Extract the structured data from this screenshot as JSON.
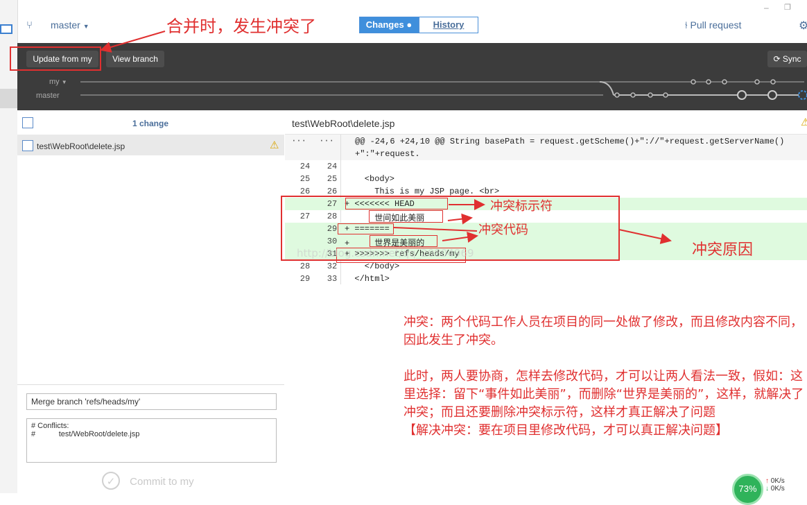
{
  "header": {
    "branch": "master",
    "tabs": [
      {
        "label": "Changes"
      },
      {
        "label": "History"
      }
    ],
    "pull_request": "Pull request"
  },
  "toolbar": {
    "update_button": "Update from my",
    "view_branch": "View branch",
    "sync": "Sync",
    "graph_labels": [
      "my",
      "master"
    ]
  },
  "changes": {
    "count_label": "1 change",
    "files": [
      {
        "path": "test\\WebRoot\\delete.jsp"
      }
    ]
  },
  "commit": {
    "summary": "Merge branch 'refs/heads/my'",
    "description_line1": "# Conflicts:",
    "description_line2": "#           test/WebRoot/delete.jsp",
    "button": "Commit to my"
  },
  "diff": {
    "file_path": "test\\WebRoot\\delete.jsp",
    "hunk_header": "@@ -24,6 +24,10 @@ String basePath = request.getScheme()+\"://\"+request.getServerName()",
    "hunk_header_cont": "+\":\"+request.",
    "lines": [
      {
        "old": "24",
        "new": "24",
        "text": ""
      },
      {
        "old": "25",
        "new": "25",
        "text": "    <body>"
      },
      {
        "old": "26",
        "new": "26",
        "text": "      This is my JSP page. <br>"
      },
      {
        "old": "",
        "new": "27",
        "text": "+ <<<<<<< HEAD"
      },
      {
        "old": "27",
        "new": "28",
        "text": "      世间如此美丽"
      },
      {
        "old": "",
        "new": "29",
        "text": "+ ======="
      },
      {
        "old": "",
        "new": "30",
        "text": "+     世界是美丽的"
      },
      {
        "old": "",
        "new": "31",
        "text": "+ >>>>>>> refs/heads/my"
      },
      {
        "old": "28",
        "new": "32",
        "text": "    </body>"
      },
      {
        "old": "29",
        "new": "33",
        "text": "  </html>"
      }
    ]
  },
  "annotations": {
    "merge_conflict": "合并时，发生冲突了",
    "marker": "冲突标示符",
    "code": "冲突代码",
    "reason": "冲突原因",
    "watermark": "http://blog.csdn.net/qq_20804969"
  },
  "notes": [
    "冲突：两个代码工作人员在项目的同一处做了修改，而且修改内容不同，因此发生了冲突。",
    "此时，两人要协商，怎样去修改代码，才可以让两人看法一致，假如：这里选择：留下“事件如此美丽”，而删除“世界是美丽的”，这样，就解决了冲突；而且还要删除冲突标示符，这样才真正解决了问题",
    "【解决冲突：要在项目里修改代码，才可以真正解决问题】"
  ],
  "status": {
    "percent": "73%",
    "up": "0K/s",
    "down": "0K/s"
  },
  "colors": {
    "accent": "#3f8fdc",
    "annotation": "#e03030",
    "added_bg": "#dffadf"
  }
}
